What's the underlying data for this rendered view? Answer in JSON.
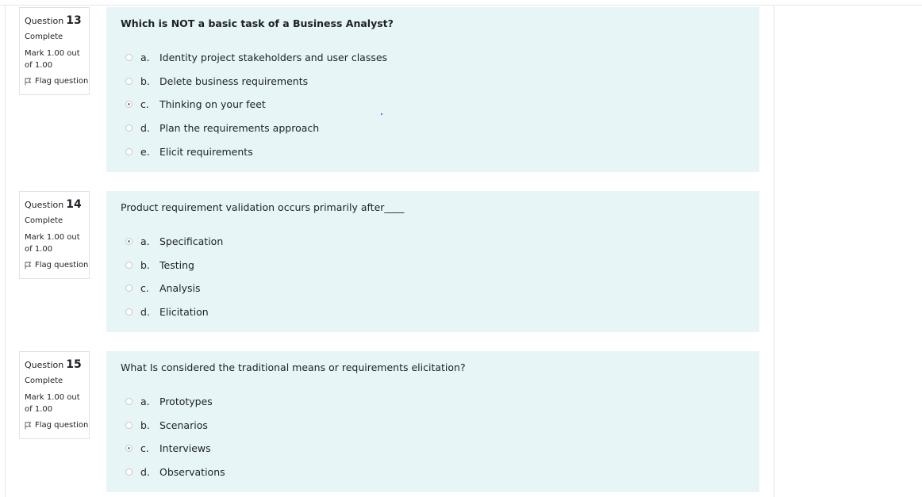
{
  "questions": [
    {
      "label": "Question",
      "number": "13",
      "state": "Complete",
      "mark": "Mark 1.00 out of 1.00",
      "flag_label": "Flag question",
      "text": "Which is NOT a basic task of a Business Analyst?",
      "answers": [
        {
          "letter": "a.",
          "text": "Identity project stakeholders and user classes",
          "selected": false
        },
        {
          "letter": "b.",
          "text": "Delete business requirements",
          "selected": false
        },
        {
          "letter": "c.",
          "text": "Thinking on your feet",
          "selected": true
        },
        {
          "letter": "d.",
          "text": "Plan the requirements approach",
          "selected": false
        },
        {
          "letter": "e.",
          "text": "Elicit requirements",
          "selected": false
        }
      ]
    },
    {
      "label": "Question",
      "number": "14",
      "state": "Complete",
      "mark": "Mark 1.00 out of 1.00",
      "flag_label": "Flag question",
      "text": "Product requirement validation occurs primarily after____",
      "answers": [
        {
          "letter": "a.",
          "text": "Specification",
          "selected": true
        },
        {
          "letter": "b.",
          "text": "Testing",
          "selected": false
        },
        {
          "letter": "c.",
          "text": "Analysis",
          "selected": false
        },
        {
          "letter": "d.",
          "text": "Elicitation",
          "selected": false
        }
      ]
    },
    {
      "label": "Question",
      "number": "15",
      "state": "Complete",
      "mark": "Mark 1.00 out of 1.00",
      "flag_label": "Flag question",
      "text": "What Is considered the traditional means or requirements elicitation?",
      "answers": [
        {
          "letter": "a.",
          "text": "Prototypes",
          "selected": false
        },
        {
          "letter": "b.",
          "text": "Scenarios",
          "selected": false
        },
        {
          "letter": "c.",
          "text": "Interviews",
          "selected": true
        },
        {
          "letter": "d.",
          "text": "Observations",
          "selected": false
        }
      ]
    }
  ]
}
